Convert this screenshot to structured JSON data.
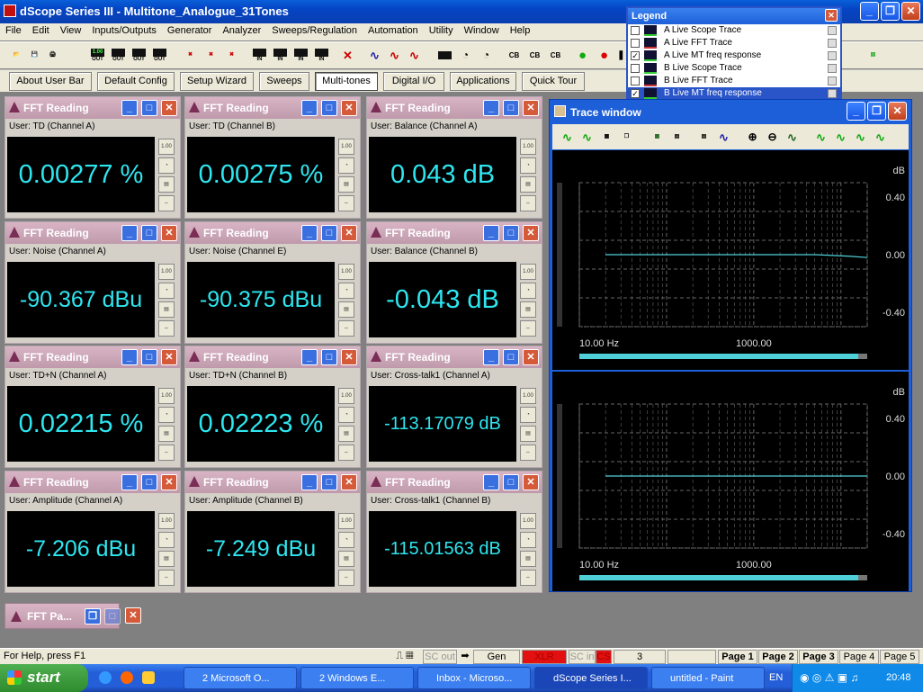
{
  "window": {
    "title": "dScope Series III - Multitone_Analogue_31Tones",
    "minimize": "_",
    "restore": "❐",
    "close": "✕"
  },
  "menu": [
    "File",
    "Edit",
    "View",
    "Inputs/Outputs",
    "Generator",
    "Analyzer",
    "Sweeps/Regulation",
    "Automation",
    "Utility",
    "Window",
    "Help"
  ],
  "toolbar_icons": [
    "open-icon",
    "save-icon",
    "print-icon",
    "output-icon",
    "output-icon",
    "output-icon",
    "output-icon",
    "output-off-icon",
    "output-off-icon",
    "output-off-icon",
    "input-icon",
    "input-icon",
    "input-icon",
    "input-icon",
    "stop-icon",
    "wave-icon",
    "wave-icon",
    "wave-icon",
    "meter-icon",
    "dial-icon",
    "dial-icon",
    "channel-icon",
    "channel-icon",
    "channel-icon",
    "go-icon",
    "record-icon",
    "pause-icon",
    "help-icon",
    "export-icon"
  ],
  "toolbar_labels": {
    "out": "OUT",
    "in": "IN",
    "val": "1.00"
  },
  "userbar": [
    "About User Bar",
    "Default Config",
    "Setup Wizard",
    "Sweeps",
    "Multi-tones",
    "Digital I/O",
    "Applications",
    "Quick Tour"
  ],
  "panel_title": "FFT Reading",
  "panels": [
    {
      "label": "User: TD (Channel A)",
      "value": "0.00277 %"
    },
    {
      "label": "User: TD (Channel B)",
      "value": "0.00275 %"
    },
    {
      "label": "User: Balance (Channel A)",
      "value": "0.043 dB"
    },
    {
      "label": "User: Noise (Channel A)",
      "value": "-90.367 dBu"
    },
    {
      "label": "User: Noise (Channel E)",
      "value": "-90.375 dBu"
    },
    {
      "label": "User: Balance (Channel B)",
      "value": "-0.043 dB"
    },
    {
      "label": "User: TD+N (Channel A)",
      "value": "0.02215 %"
    },
    {
      "label": "User: TD+N (Channel B)",
      "value": "0.02223 %"
    },
    {
      "label": "User: Cross-talk1 (Channel A)",
      "value": "-113.17079 dB"
    },
    {
      "label": "User: Amplitude (Channel A)",
      "value": "-7.206 dBu"
    },
    {
      "label": "User: Amplitude (Channel B)",
      "value": "-7.249 dBu"
    },
    {
      "label": "User: Cross-talk1 (Channel B)",
      "value": "-115.01563 dB"
    }
  ],
  "panel_side_label": "1.00",
  "legend": {
    "title": "Legend",
    "items": [
      {
        "label": "A  Live Scope Trace",
        "checked": false
      },
      {
        "label": "A  Live FFT Trace",
        "checked": false
      },
      {
        "label": "A  Live MT freq response",
        "checked": true
      },
      {
        "label": "B  Live Scope Trace",
        "checked": false
      },
      {
        "label": "B  Live FFT Trace",
        "checked": false
      },
      {
        "label": "B  Live MT freq response",
        "checked": true
      }
    ]
  },
  "trace_window": {
    "title": "Trace window",
    "plots": [
      {
        "unit": "dB",
        "yticks": [
          "0.40",
          "0.00",
          "-0.40"
        ],
        "xticks": [
          "10.00 Hz",
          "1000.00"
        ],
        "trace_color": "#4fd0d8"
      },
      {
        "unit": "dB",
        "yticks": [
          "0.40",
          "0.00",
          "-0.40"
        ],
        "xticks": [
          "10.00 Hz",
          "1000.00"
        ],
        "trace_color": "#4fd0d8"
      }
    ]
  },
  "fft_min": "FFT Pa...",
  "status": {
    "help": "For Help, press F1",
    "sc_out": "SC out",
    "gen": "Gen",
    "xlr": "XLR",
    "sc_in": "SC in",
    "ch": "CS",
    "num": "3",
    "pages": [
      "Page 1",
      "Page 2",
      "Page 3",
      "Page 4",
      "Page 5"
    ]
  },
  "taskbar": {
    "start": "start",
    "tasks": [
      "2 Microsoft O...",
      "2 Windows E...",
      "Inbox - Microso...",
      "dScope Series I...",
      "untitled - Paint"
    ],
    "lang": "EN",
    "clock": "20:48"
  }
}
